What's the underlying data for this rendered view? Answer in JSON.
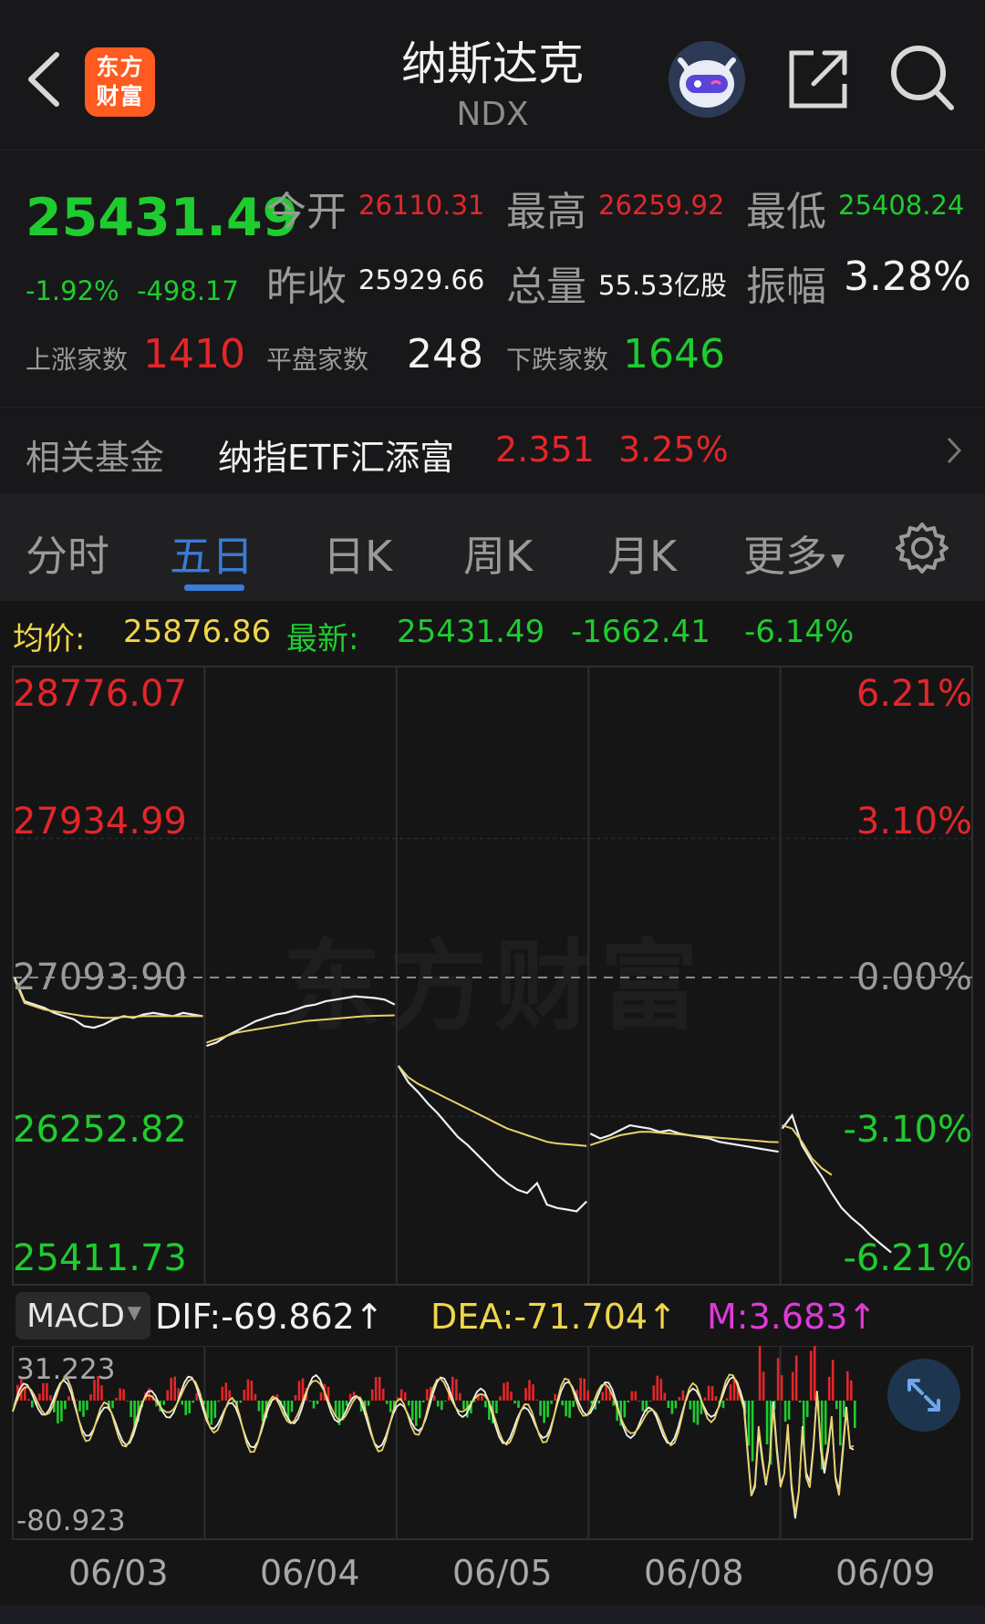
{
  "header": {
    "title": "纳斯达克",
    "subtitle": "NDX",
    "logo_text_line1": "东方",
    "logo_text_line2": "财富",
    "icons": [
      "back-icon",
      "robot-icon",
      "share-icon",
      "search-icon"
    ]
  },
  "quote": {
    "price": "25431.49",
    "change_pct": "-1.92%",
    "change_abs": "-498.17",
    "open_label": "今开",
    "open": "26110.31",
    "high_label": "最高",
    "high": "26259.92",
    "low_label": "最低",
    "low": "25408.24",
    "prev_close_label": "昨收",
    "prev_close": "25929.66",
    "volume_label": "总量",
    "volume": "55.53亿股",
    "amplitude_label": "振幅",
    "amplitude": "3.28%",
    "up_label": "上涨家数",
    "up": "1410",
    "flat_label": "平盘家数",
    "flat": "248",
    "down_label": "下跌家数",
    "down": "1646"
  },
  "fund": {
    "label": "相关基金",
    "name": "纳指ETF汇添富",
    "price": "2.351",
    "pct": "3.25%"
  },
  "tabs": [
    "分时",
    "五日",
    "日K",
    "周K",
    "月K",
    "更多"
  ],
  "active_tab": "五日",
  "infoline": {
    "avg_label": "均价:",
    "avg": "25876.86",
    "latest_label": "最新:",
    "latest": "25431.49",
    "change": "-1662.41",
    "pct": "-6.14%"
  },
  "watermark": "东方财富",
  "macd": {
    "selector": "MACD",
    "dif": "DIF:-69.862↑",
    "dea": "DEA:-71.704↑",
    "m": "M:3.683↑",
    "ymax_label": "31.223",
    "ymin_label": "-80.923"
  },
  "colors": {
    "up": "#e3262a",
    "down": "#1fcc2f",
    "price_line": "#f0f0f0",
    "avg_line": "#e8d36a",
    "accent": "#3a7bd5",
    "macd_m": "#e03ad8"
  },
  "chart_data": {
    "type": "line",
    "title": "",
    "x_labels": [
      "06/03",
      "06/04",
      "06/05",
      "06/08",
      "06/09"
    ],
    "y_left_labels": [
      "28776.07",
      "27934.99",
      "27093.90",
      "26252.82",
      "25411.73"
    ],
    "y_right_labels": [
      "6.21%",
      "3.10%",
      "0.00%",
      "-3.10%",
      "-6.21%"
    ],
    "ylim": [
      25411.73,
      28776.07
    ],
    "reference_close": 27093.9,
    "series": [
      {
        "name": "",
        "days": [
          [
            27093,
            26950,
            26930,
            26910,
            26880,
            26860,
            26840,
            26800,
            26790,
            26810,
            26840,
            26860,
            26850,
            26870,
            26880,
            26870,
            26860,
            26880,
            26870,
            26860
          ],
          [
            26680,
            26700,
            26740,
            26770,
            26800,
            26830,
            26850,
            26870,
            26880,
            26900,
            26920,
            26930,
            26950,
            26960,
            26970,
            26980,
            26975,
            26970,
            26960,
            26930
          ],
          [
            26560,
            26460,
            26400,
            26330,
            26270,
            26200,
            26130,
            26080,
            26020,
            25960,
            25900,
            25850,
            25810,
            25790,
            25850,
            25720,
            25700,
            25690,
            25680,
            25740
          ],
          [
            26150,
            26120,
            26140,
            26170,
            26200,
            26190,
            26180,
            26160,
            26170,
            26150,
            26140,
            26130,
            26120,
            26100,
            26090,
            26080,
            26070,
            26060,
            26050,
            26040
          ],
          [
            26180,
            26260,
            26080,
            25980,
            25890,
            25790,
            25700,
            25640,
            25590,
            25530,
            25480,
            25431
          ]
        ]
      },
      {
        "name": "",
        "days": [
          [
            27080,
            26940,
            26920,
            26900,
            26890,
            26880,
            26870,
            26860,
            26855,
            26850,
            26850,
            26855,
            26855,
            26860,
            26860,
            26860,
            26860,
            26860,
            26860,
            26860
          ],
          [
            26700,
            26720,
            26740,
            26760,
            26770,
            26780,
            26790,
            26800,
            26810,
            26820,
            26830,
            26835,
            26840,
            26845,
            26850,
            26855,
            26860,
            26862,
            26864,
            26865
          ],
          [
            26560,
            26490,
            26450,
            26420,
            26390,
            26360,
            26330,
            26300,
            26270,
            26240,
            26210,
            26180,
            26160,
            26140,
            26120,
            26100,
            26090,
            26085,
            26080,
            26075
          ],
          [
            26080,
            26100,
            26120,
            26140,
            26150,
            26160,
            26160,
            26155,
            26150,
            26145,
            26140,
            26135,
            26130,
            26125,
            26120,
            26115,
            26110,
            26105,
            26100,
            26098
          ],
          [
            26200,
            26180,
            26100,
            26000,
            25940,
            25900
          ]
        ]
      }
    ]
  }
}
